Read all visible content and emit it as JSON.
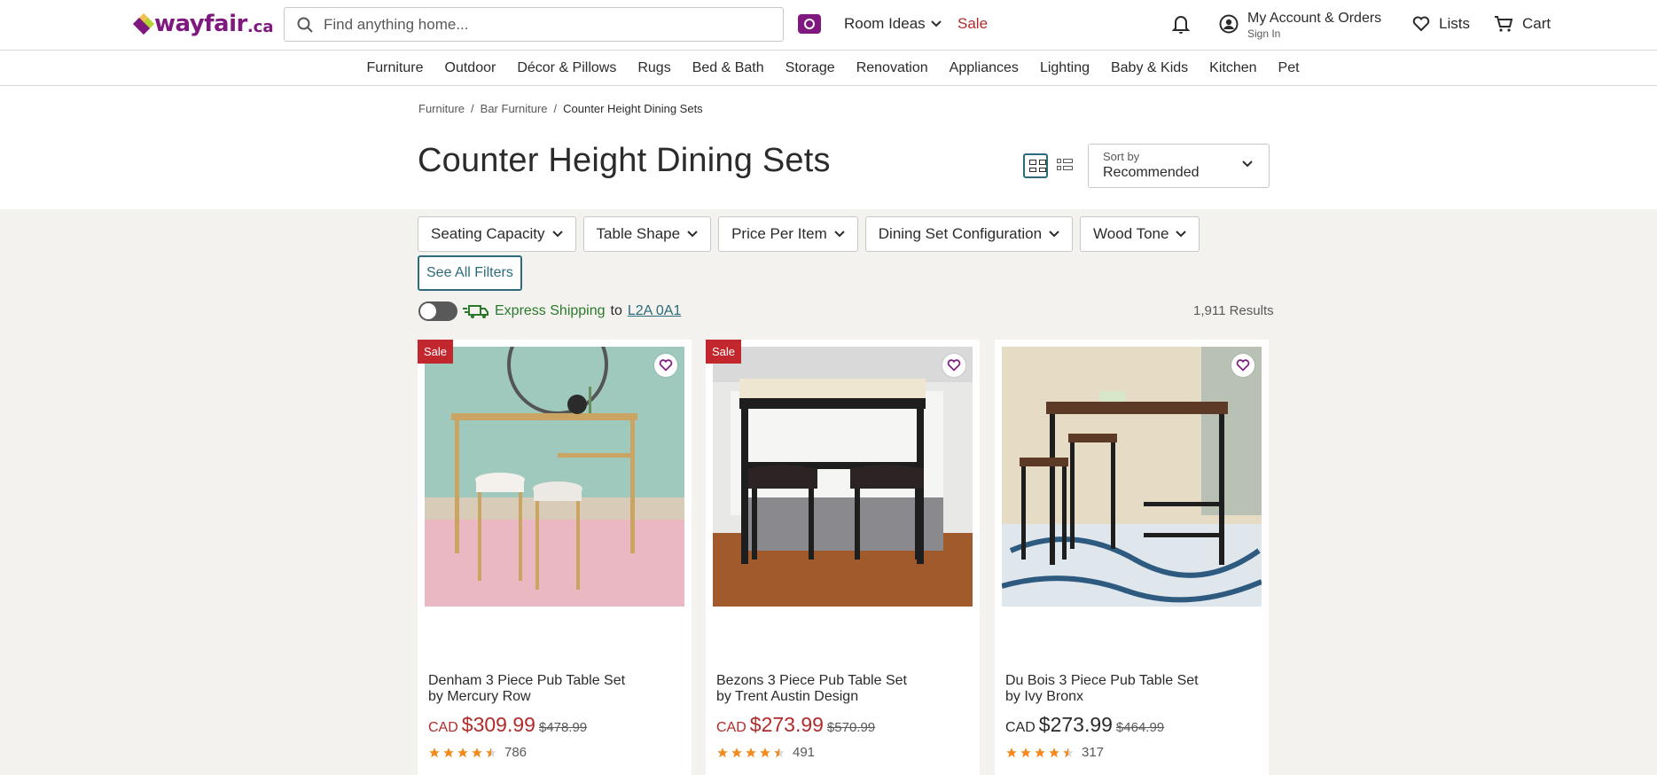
{
  "header": {
    "logo": {
      "text": "wayfair",
      "tld": ".ca"
    },
    "search_placeholder": "Find anything home...",
    "room_ideas": "Room Ideas",
    "sale": "Sale",
    "account_main": "My Account & Orders",
    "account_sub": "Sign In",
    "lists": "Lists",
    "cart": "Cart"
  },
  "nav": [
    "Furniture",
    "Outdoor",
    "Décor & Pillows",
    "Rugs",
    "Bed & Bath",
    "Storage",
    "Renovation",
    "Appliances",
    "Lighting",
    "Baby & Kids",
    "Kitchen",
    "Pet"
  ],
  "breadcrumb": [
    "Furniture",
    "Bar Furniture",
    "Counter Height Dining Sets"
  ],
  "breadcrumb_separator": "/",
  "page_title": "Counter Height Dining Sets",
  "sort": {
    "label": "Sort by",
    "value": "Recommended"
  },
  "filters": [
    "Seating Capacity",
    "Table Shape",
    "Price Per Item",
    "Dining Set Configuration",
    "Wood Tone"
  ],
  "see_all_filters": "See All Filters",
  "express": {
    "label": "Express Shipping",
    "to": "to",
    "zip": "L2A 0A1"
  },
  "results": "1,911 Results",
  "products": [
    {
      "badge": "Sale",
      "name": "Denham 3 Piece Pub Table Set",
      "brand": "by Mercury Row",
      "currency": "CAD",
      "price": "$309.99",
      "was": "$478.99",
      "rating": 4.5,
      "reviews": "786"
    },
    {
      "badge": "Sale",
      "name": "Bezons 3 Piece Pub Table Set",
      "brand": "by Trent Austin Design",
      "currency": "CAD",
      "price": "$273.99",
      "was": "$570.99",
      "rating": 4.5,
      "reviews": "491"
    },
    {
      "badge": "",
      "name": "Du Bois 3 Piece Pub Table Set",
      "brand": "by Ivy Bronx",
      "currency": "CAD",
      "price": "$273.99",
      "was": "$464.99",
      "rating": 4.5,
      "reviews": "317"
    }
  ],
  "colors": {
    "brand": "#7f187f",
    "sale": "#b12b2b",
    "accent": "#2b6b7a",
    "express_green": "#2b7a2b",
    "star": "#f28a1e",
    "content_bg": "#f3f2ee"
  }
}
